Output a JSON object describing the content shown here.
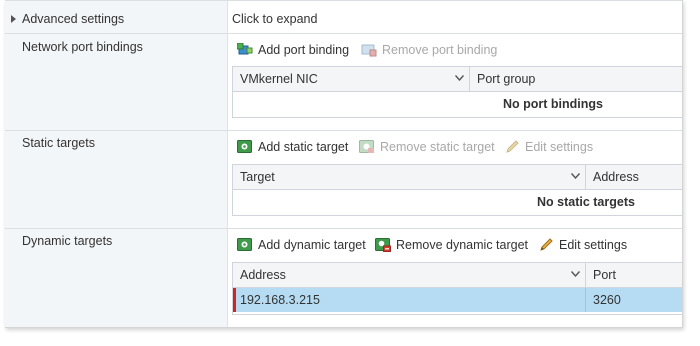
{
  "advanced": {
    "label": "Advanced settings",
    "value": "Click to expand"
  },
  "port_bindings": {
    "label": "Network port bindings",
    "add_label": "Add port binding",
    "remove_label": "Remove port binding",
    "columns": [
      "VMkernel NIC",
      "Port group"
    ],
    "empty_text": "No port bindings"
  },
  "static_targets": {
    "label": "Static targets",
    "add_label": "Add static target",
    "remove_label": "Remove static target",
    "edit_label": "Edit settings",
    "columns": [
      "Target",
      "Address"
    ],
    "empty_text": "No static targets"
  },
  "dynamic_targets": {
    "label": "Dynamic targets",
    "add_label": "Add dynamic target",
    "remove_label": "Remove dynamic target",
    "edit_label": "Edit settings",
    "columns": [
      "Address",
      "Port"
    ],
    "rows": [
      {
        "address": "192.168.3.215",
        "port": "3260"
      }
    ]
  },
  "colors": {
    "label_column_bg": "#f3f6f9",
    "selected_row_bg": "#b5dcf3",
    "selected_marker": "#d6211d",
    "disabled_text": "#a8a8a8"
  }
}
